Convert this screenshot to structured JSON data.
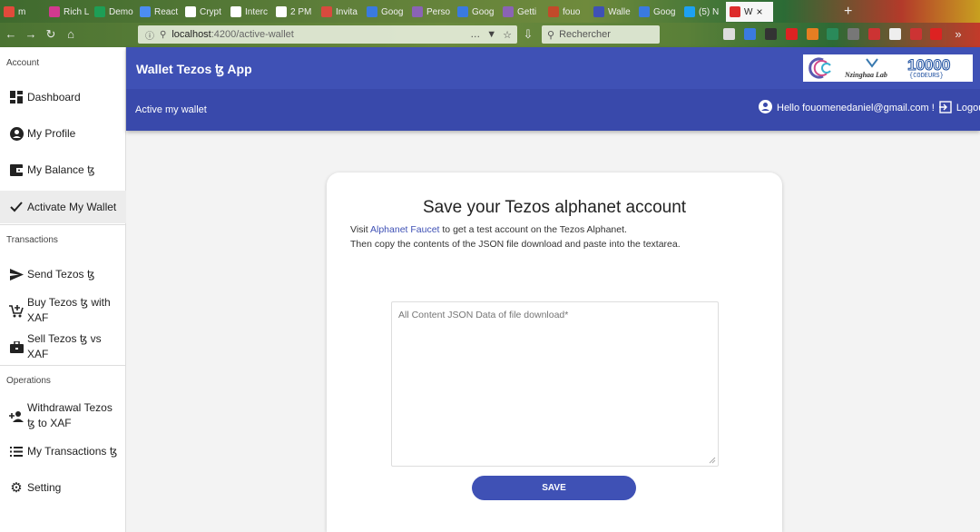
{
  "browser": {
    "tabs": [
      {
        "label": "m",
        "color": "#e24a3b"
      },
      {
        "label": "Rich L",
        "color": "#d23a8f"
      },
      {
        "label": "Demo",
        "color": "#1e9e56"
      },
      {
        "label": "React",
        "color": "#4c8df0"
      },
      {
        "label": "Crypt",
        "color": "#ffffff"
      },
      {
        "label": "Interc",
        "color": "#ffffff"
      },
      {
        "label": "2 PM",
        "color": "#ffffff"
      },
      {
        "label": "Invita",
        "color": "#d84a3e"
      },
      {
        "label": "Goog",
        "color": "#3a7ae0"
      },
      {
        "label": "Perso",
        "color": "#8a63b5"
      },
      {
        "label": "Goog",
        "color": "#3a7ae0"
      },
      {
        "label": "Getti",
        "color": "#8a63b5"
      },
      {
        "label": "fouo",
        "color": "#c24a2a"
      },
      {
        "label": "Walle",
        "color": "#3f51b5"
      },
      {
        "label": "Goog",
        "color": "#3a7ae0"
      },
      {
        "label": "(5) N",
        "color": "#1da1f2"
      },
      {
        "label": "W",
        "color": "#dd2c2c"
      }
    ],
    "url": "localhost:4200/active-wallet",
    "url_host": "localhost",
    "url_path": ":4200/active-wallet",
    "search_placeholder": "Rechercher"
  },
  "sidebar": {
    "section_account": "Account",
    "section_transactions": "Transactions",
    "section_operations": "Operations",
    "items": [
      {
        "label": "Dashboard",
        "icon": "dashboard-icon"
      },
      {
        "label": "My Profile",
        "icon": "account-circle-icon"
      },
      {
        "label": "My Balance ꜩ",
        "icon": "wallet-icon"
      },
      {
        "label": "Activate My Wallet",
        "icon": "check-icon"
      },
      {
        "label": "Send Tezos ꜩ",
        "icon": "send-icon"
      },
      {
        "label": "Buy Tezos ꜩ with XAF",
        "icon": "cart-add-icon"
      },
      {
        "label": "Sell Tezos ꜩ vs XAF",
        "icon": "toolbox-icon"
      },
      {
        "label": "Withdrawal Tezos ꜩ to XAF",
        "icon": "person-add-icon"
      },
      {
        "label": "My Transactions ꜩ",
        "icon": "list-icon"
      },
      {
        "label": "Setting",
        "icon": "gear-icon"
      }
    ]
  },
  "header": {
    "app_title": "Wallet Tezos ꜩ App",
    "page_title": "Active my wallet",
    "user_greeting": "Hello fouomenedaniel@gmail.com !",
    "logout_label": "Logout",
    "logo_text_left": "Nzinghaa Lab",
    "logo_number": "10000",
    "logo_codeurs": "{CODEURS}",
    "accent": "#3f51b5"
  },
  "card": {
    "title": "Save your Tezos alphanet account",
    "line1_prefix": "Visit",
    "line1_link": "Alphanet Faucet",
    "line1_suffix": "to get a test account on the Tezos Alphanet.",
    "line2": "Then copy the contents of the JSON file download and paste into the textarea.",
    "textarea_placeholder": "All Content JSON Data of file download*",
    "save_label": "SAVE"
  }
}
